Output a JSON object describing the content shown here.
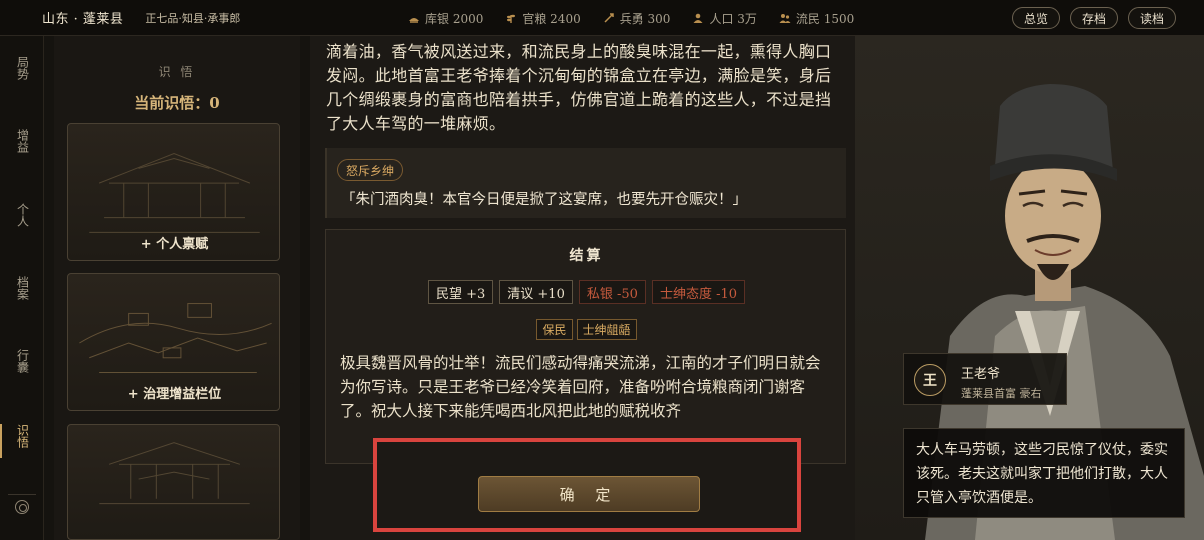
{
  "header": {
    "location": "山东 · 蓬莱县",
    "rank": "正七品·知县·承事郎",
    "stats": [
      {
        "icon": "silver-icon",
        "label": "库银 2000"
      },
      {
        "icon": "grain-icon",
        "label": "官粮 2400"
      },
      {
        "icon": "soldier-icon",
        "label": "兵勇 300"
      },
      {
        "icon": "population-icon",
        "label": "人口 3万"
      },
      {
        "icon": "refugee-icon",
        "label": "流民 1500"
      }
    ],
    "actions": [
      "总览",
      "存档",
      "读档"
    ]
  },
  "nav": {
    "items": [
      "局势",
      "增益",
      "个人",
      "档案",
      "行囊",
      "识悟"
    ],
    "active": "识悟"
  },
  "wisdom": {
    "caption": "识 悟",
    "current": "当前识悟：0",
    "cards": [
      "+ 个人禀赋",
      "+ 治理增益栏位",
      ""
    ]
  },
  "story": {
    "paragraph": "滴着油，香气被风送过来，和流民身上的酸臭味混在一起，熏得人胸口发闷。此地首富王老爷捧着个沉甸甸的锦盒立在亭边，满脸是笑，身后几个绸缎裹身的富商也陪着拱手，仿佛官道上跪着的这些人，不过是挡了大人车驾的一堆麻烦。",
    "choice_tag": "怒斥乡绅",
    "choice_line": "「朱门酒肉臭！本官今日便是掀了这宴席，也要先开仓赈灾！」",
    "settle_title": "结算",
    "effects": [
      {
        "label": "民望 +3",
        "type": "pos"
      },
      {
        "label": "清议 +10",
        "type": "pos"
      },
      {
        "label": "私银 -50",
        "type": "neg"
      },
      {
        "label": "士绅态度 -10",
        "type": "neg"
      }
    ],
    "traits": [
      "保民",
      "士绅龃龉"
    ],
    "result": "极具魏晋风骨的壮举！流民们感动得痛哭流涕，江南的才子们明日就会为你写诗。只是王老爷已经冷笑着回府，准备吩咐合境粮商闭门谢客了。祝大人接下来能凭喝西北风把此地的赋税收齐",
    "confirm": "确 定"
  },
  "character": {
    "badge": "王",
    "name": "王老爷",
    "title": "蓬莱县首富  豪右",
    "quote": "大人车马劳顿，这些刁民惊了仪仗，委实该死。老夫这就叫家丁把他们打散，大人只管入亭饮酒便是。"
  },
  "colors": {
    "accent_gold": "#c9a25f",
    "negative": "#c55a3d",
    "highlight_box": "#d9443e"
  }
}
